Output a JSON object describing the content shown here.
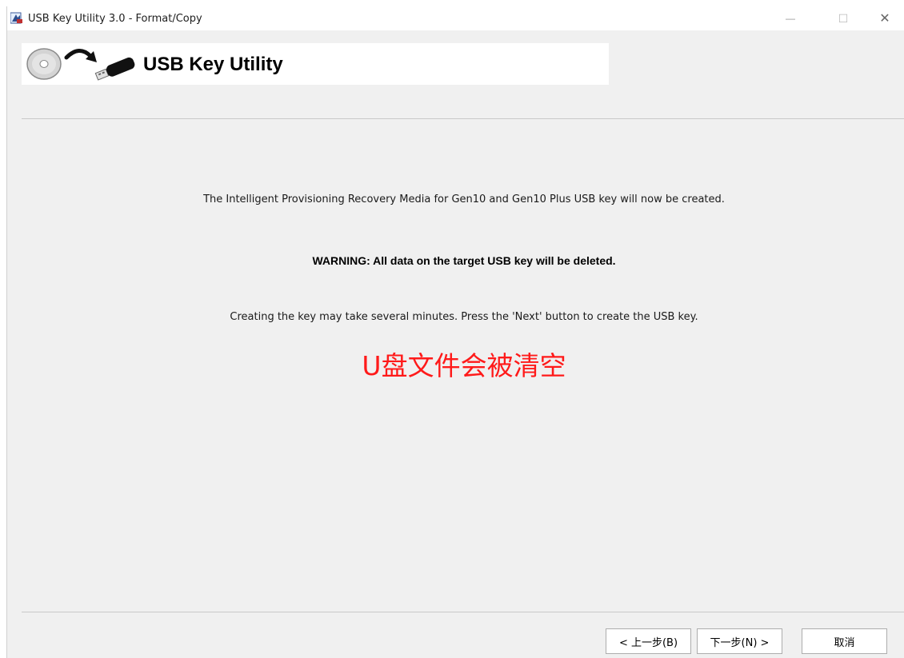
{
  "window": {
    "title": "USB Key Utility 3.0 - Format/Copy",
    "minimize_glyph": "—",
    "maximize_glyph": "☐",
    "close_glyph": "✕"
  },
  "banner": {
    "title": "USB Key Utility",
    "icons": [
      "cd-disc-icon",
      "curved-arrow-icon",
      "usb-key-icon"
    ]
  },
  "content": {
    "info": "The Intelligent Provisioning Recovery Media for Gen10 and Gen10 Plus USB key will now be created.",
    "warning": "WARNING: All data on the target USB key will be deleted.",
    "instruction": "Creating the key may take several minutes.  Press the 'Next' button to create the USB key.",
    "annotation": "U盘文件会被清空",
    "annotation_color": "#ff1a1a"
  },
  "buttons": {
    "back": "< 上一步(B)",
    "next": "下一步(N) >",
    "cancel": "取消"
  }
}
